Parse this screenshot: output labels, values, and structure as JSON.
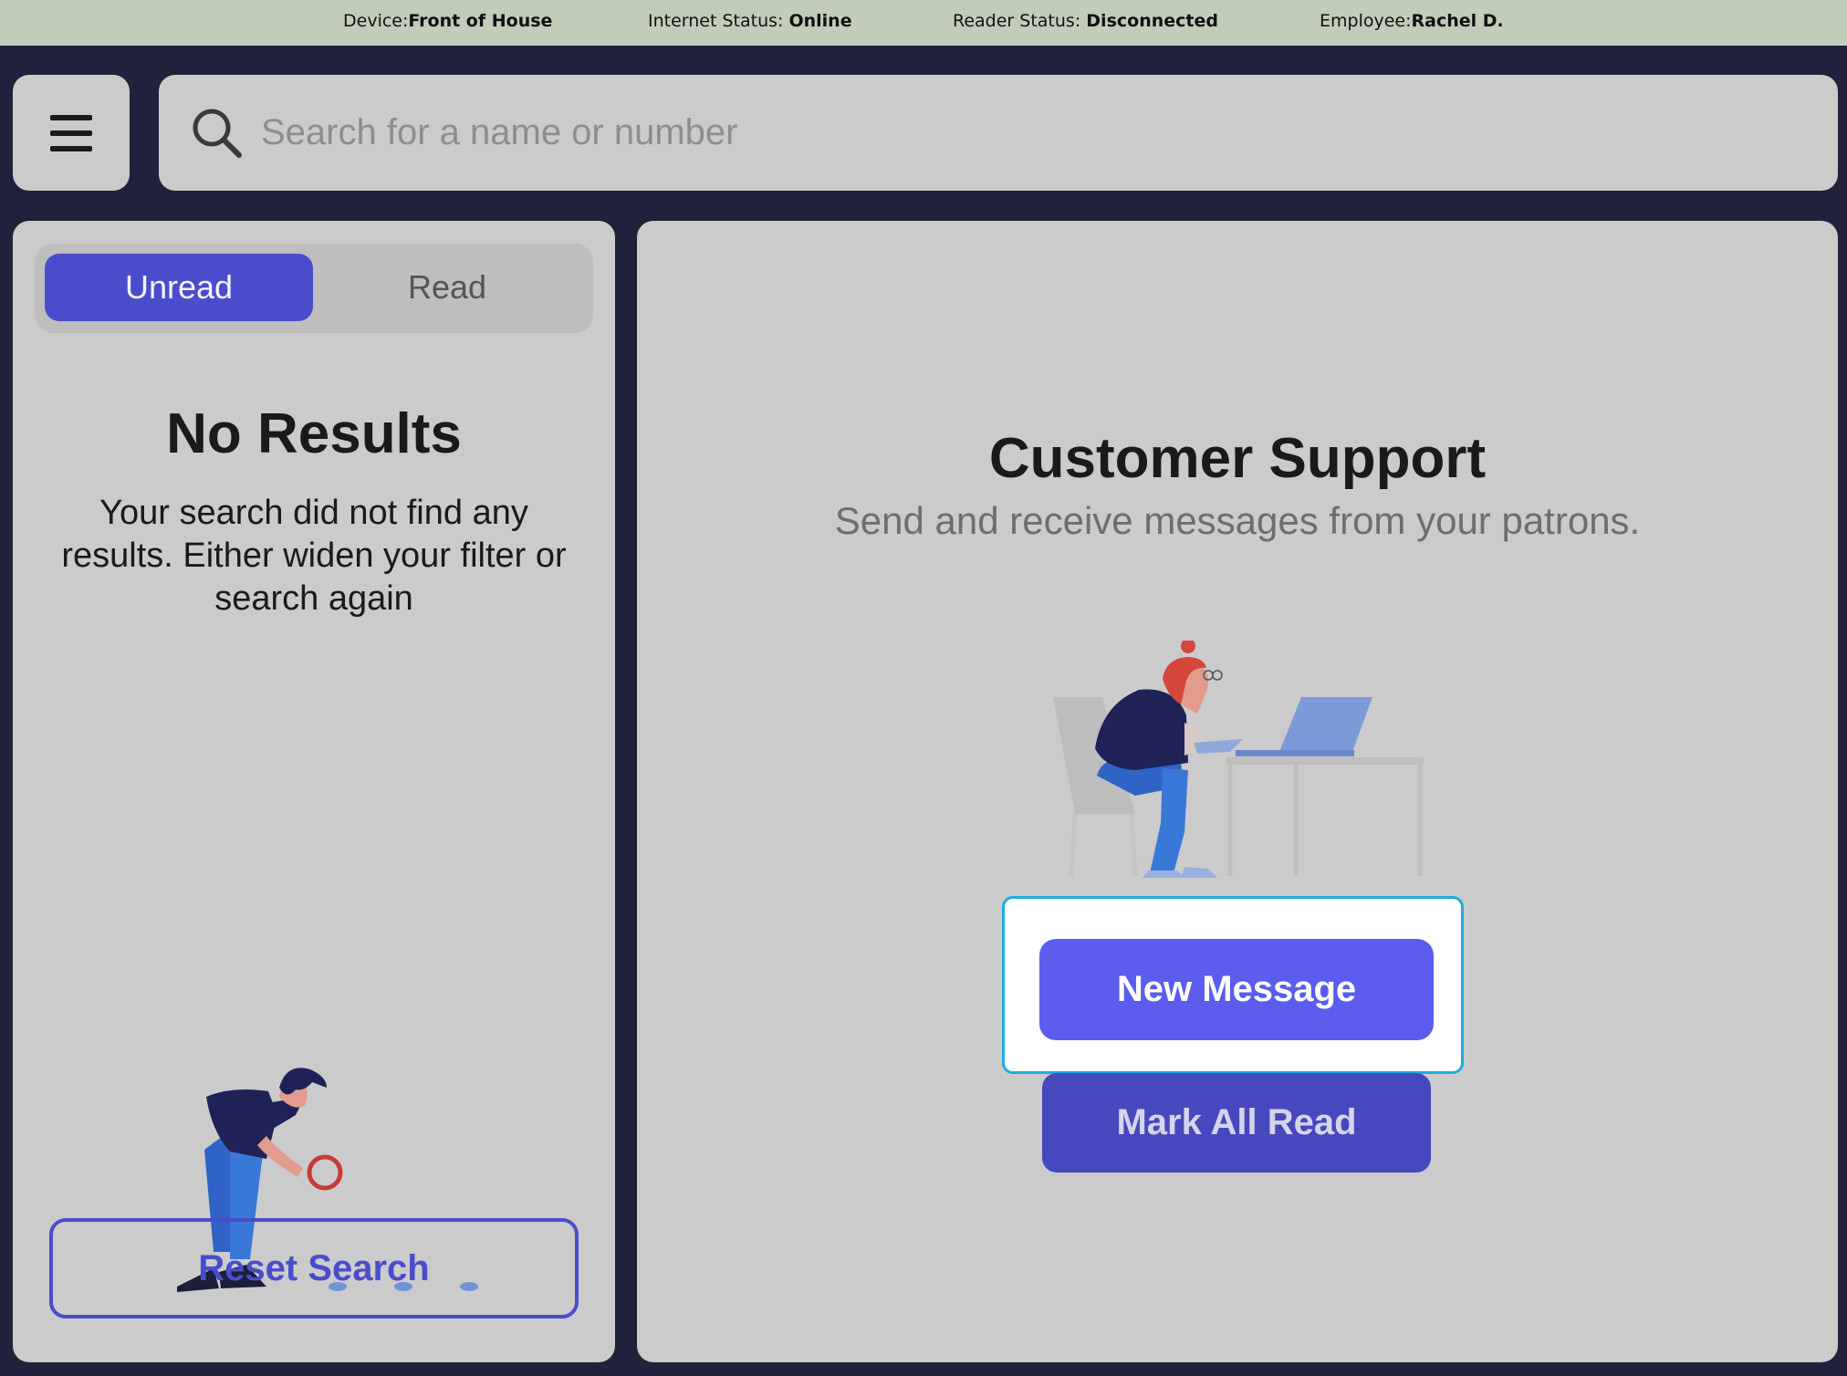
{
  "status_bar": {
    "device_label": "Device:",
    "device_value": "Front of House",
    "internet_label": "Internet Status: ",
    "internet_value": "Online",
    "reader_label": "Reader Status: ",
    "reader_value": "Disconnected",
    "employee_label": "Employee:",
    "employee_value": "Rachel D."
  },
  "header": {
    "menu_icon": "hamburger-icon",
    "search_icon": "search-icon",
    "search_placeholder": "Search for a name or number",
    "search_value": ""
  },
  "left_panel": {
    "tabs": [
      {
        "label": "Unread",
        "active": true
      },
      {
        "label": "Read",
        "active": false
      }
    ],
    "empty_title": "No Results",
    "empty_text": "Your search did not find any results. Either widen your filter or search again",
    "reset_label": "Reset Search"
  },
  "right_panel": {
    "title": "Customer Support",
    "subtitle": "Send and receive messages from your patrons.",
    "new_message_label": "New Message",
    "mark_all_read_label": "Mark All Read"
  },
  "colors": {
    "background": "#20223c",
    "status_bar": "#c2cdb9",
    "panel": "#cbcbcb",
    "accent": "#4a4dcb",
    "primary_button": "#5a5ded",
    "focus_ring": "#1eaee0"
  }
}
